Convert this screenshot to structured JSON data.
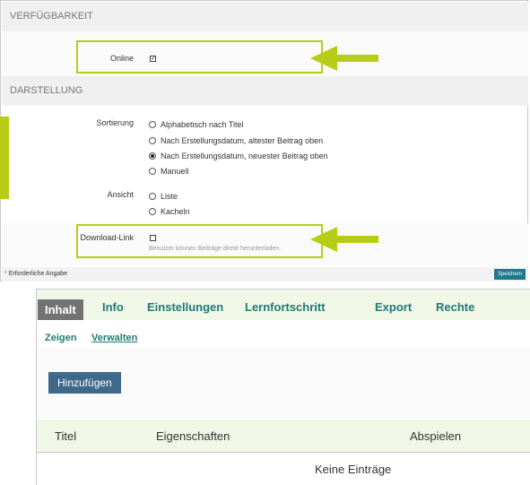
{
  "settings": {
    "section_availability": "VERFÜGBARKEIT",
    "online_label": "Online",
    "online_checked": true,
    "section_display": "DARSTELLUNG",
    "sort_label": "Sortierung",
    "sort_options": [
      {
        "label": "Alphabetisch nach Titel",
        "selected": false
      },
      {
        "label": "Nach Erstellungsdatum, altester Beitrag oben",
        "selected": false
      },
      {
        "label": "Nach Erstellungsdatum, neuester Beitrag oben",
        "selected": true
      },
      {
        "label": "Manuell",
        "selected": false
      }
    ],
    "view_label": "Ansicht",
    "view_options": [
      {
        "label": "Liste",
        "selected": false
      },
      {
        "label": "Kacheln",
        "selected": false
      }
    ],
    "download_label": "Download-Link",
    "download_checked": false,
    "download_hint": "Benutzer können Beiträge direkt herunterladen.",
    "required_star": "*",
    "required_note": "Erforderliche Angabe",
    "save_label": "Speichern",
    "accent_color": "#b8cc16"
  },
  "content": {
    "tabs": [
      "Inhalt",
      "Info",
      "Einstellungen",
      "Lernfortschritt",
      "Export",
      "Rechte"
    ],
    "active_tab": "Inhalt",
    "subtabs": [
      "Zeigen",
      "Verwalten"
    ],
    "add_button": "Hinzufügen",
    "columns": [
      "Titel",
      "Eigenschaften",
      "Abspielen"
    ],
    "empty_text": "Keine Einträge"
  }
}
